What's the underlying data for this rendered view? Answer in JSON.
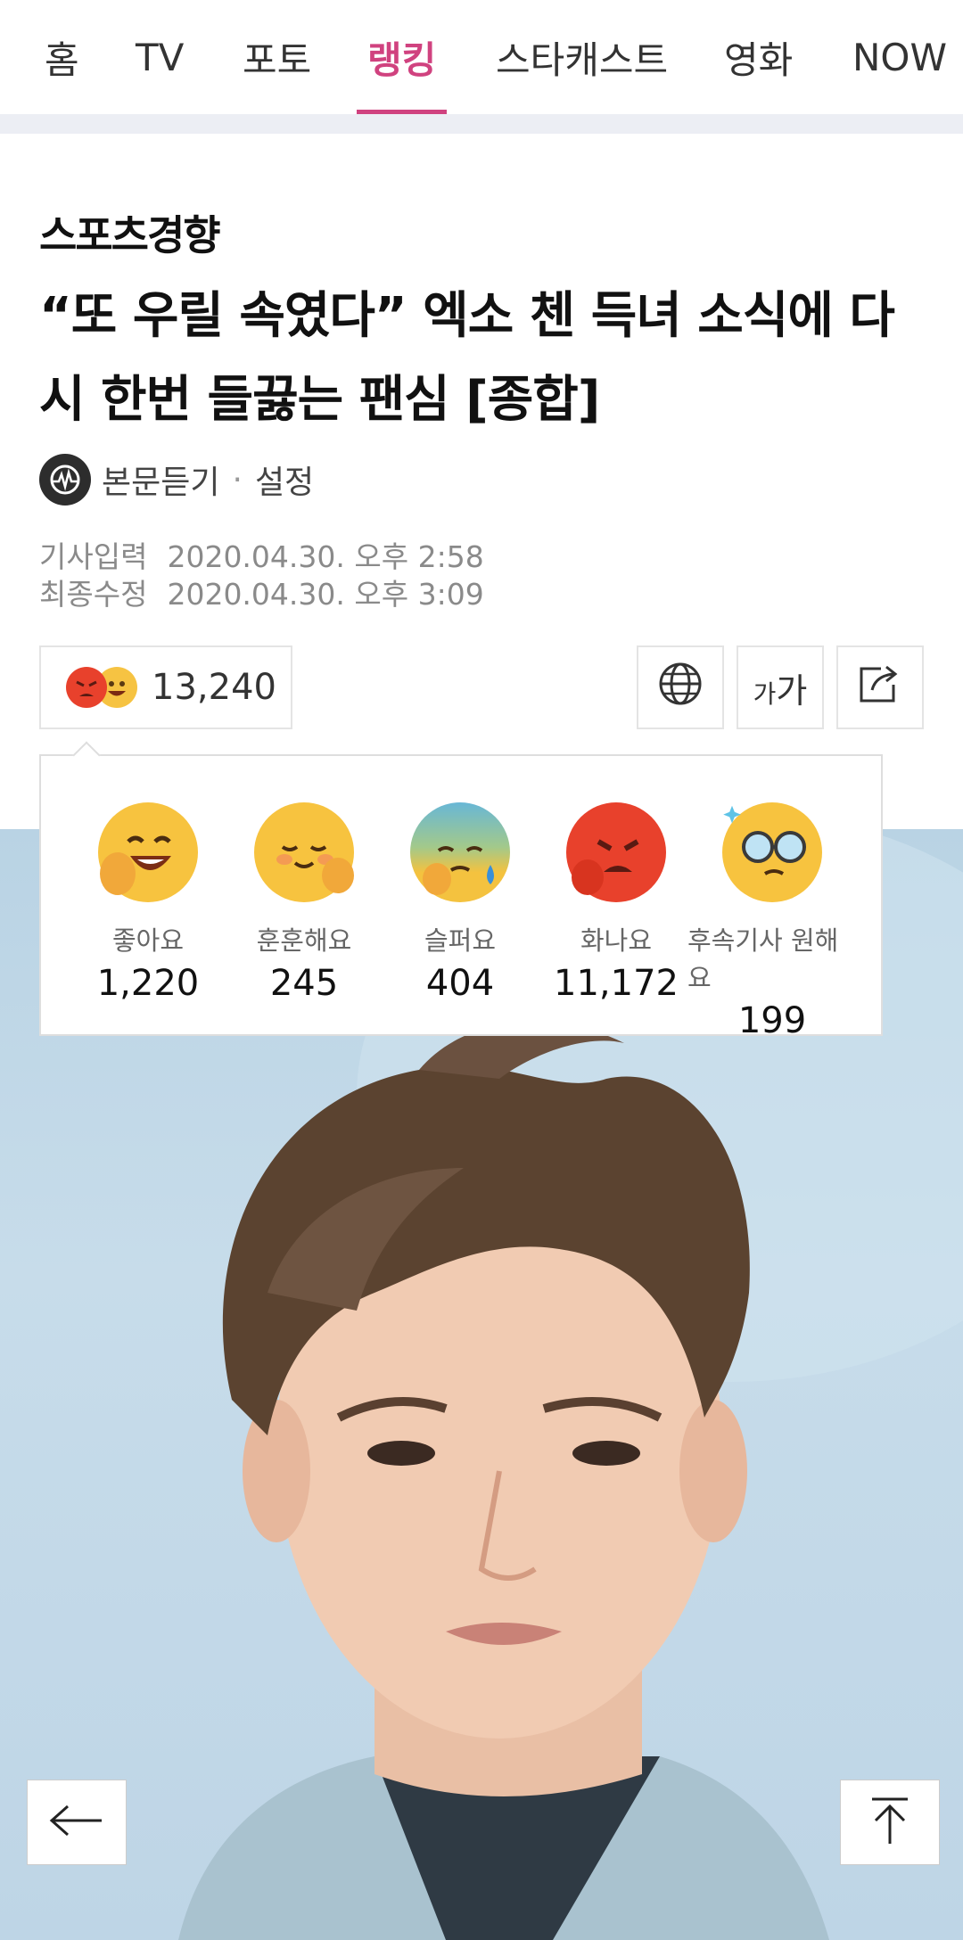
{
  "nav": {
    "tabs": [
      {
        "label": "홈"
      },
      {
        "label": "TV"
      },
      {
        "label": "포토"
      },
      {
        "label": "랭킹",
        "active": true
      },
      {
        "label": "스타캐스트"
      },
      {
        "label": "영화"
      },
      {
        "label": "NOW"
      }
    ],
    "active_color": "#d0427f"
  },
  "article": {
    "press": "스포츠경향",
    "title": "“또 우릴 속였다” 엑소 첸 득녀 소식에 다시 한번 들끓는 팬심 [종합]",
    "listen_label": "본문듣기",
    "settings_label": "설정",
    "published_label": "기사입력",
    "published": "2020.04.30. 오후 2:58",
    "modified_label": "최종수정",
    "modified": "2020.04.30. 오후 3:09"
  },
  "reactions": {
    "total": "13,240",
    "items": [
      {
        "label": "좋아요",
        "count": "1,220",
        "icon": "like-emoji-icon"
      },
      {
        "label": "훈훈해요",
        "count": "245",
        "icon": "warm-emoji-icon"
      },
      {
        "label": "슬퍼요",
        "count": "404",
        "icon": "sad-emoji-icon"
      },
      {
        "label": "화나요",
        "count": "11,172",
        "icon": "angry-emoji-icon"
      },
      {
        "label": "후속기사 원해요",
        "count": "199",
        "icon": "want-more-emoji-icon"
      }
    ]
  },
  "toolbar": {
    "font_size_small": "가",
    "font_size_large": "가",
    "icons": [
      "globe-icon",
      "font-size-icon",
      "share-icon"
    ]
  },
  "floating": {
    "back_icon": "back-arrow-icon",
    "top_icon": "scroll-top-icon"
  }
}
